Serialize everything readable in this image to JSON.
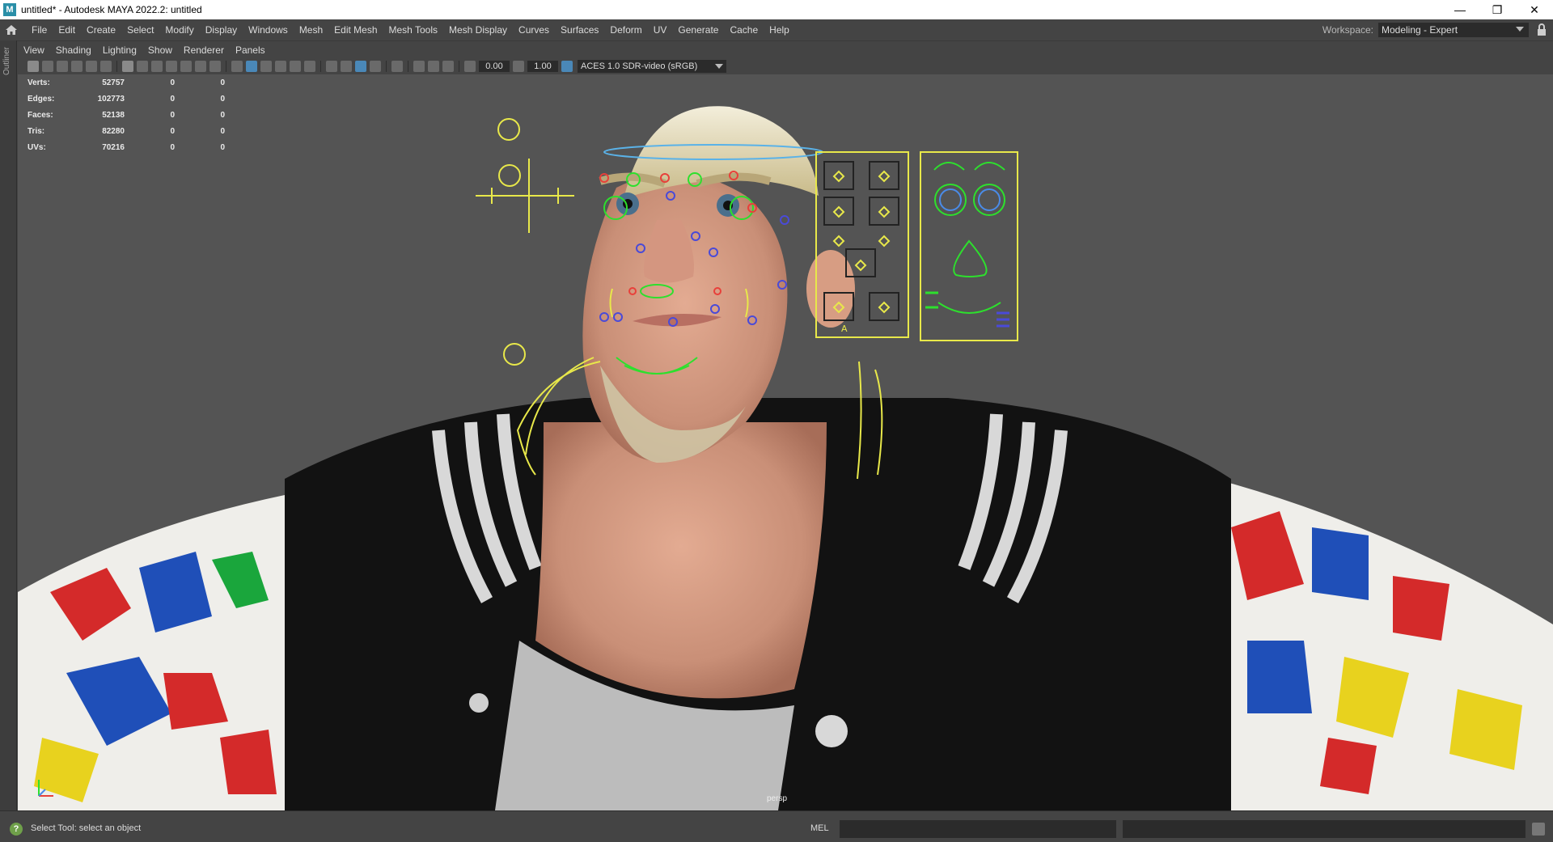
{
  "window": {
    "title": "untitled* - Autodesk MAYA 2022.2: untitled",
    "minimize": "—",
    "maximize": "❐",
    "close": "✕"
  },
  "menubar": {
    "items": [
      "File",
      "Edit",
      "Create",
      "Select",
      "Modify",
      "Display",
      "Windows",
      "Mesh",
      "Edit Mesh",
      "Mesh Tools",
      "Mesh Display",
      "Curves",
      "Surfaces",
      "Deform",
      "UV",
      "Generate",
      "Cache",
      "Help"
    ],
    "workspace_label": "Workspace:",
    "workspace_value": "Modeling - Expert"
  },
  "outliner_tab": "Outliner",
  "panel_menu": [
    "View",
    "Shading",
    "Lighting",
    "Show",
    "Renderer",
    "Panels"
  ],
  "viewport_toolbar": {
    "exposure": "0.00",
    "gamma": "1.00",
    "color_space": "ACES 1.0 SDR-video (sRGB)"
  },
  "hud": [
    {
      "label": "Verts:",
      "value": "52757",
      "sel": "0",
      "comp": "0"
    },
    {
      "label": "Edges:",
      "value": "102773",
      "sel": "0",
      "comp": "0"
    },
    {
      "label": "Faces:",
      "value": "52138",
      "sel": "0",
      "comp": "0"
    },
    {
      "label": "Tris:",
      "value": "82280",
      "sel": "0",
      "comp": "0"
    },
    {
      "label": "UVs:",
      "value": "70216",
      "sel": "0",
      "comp": "0"
    }
  ],
  "camera_label": "persp",
  "command_line": {
    "help_text": "Select Tool: select an object",
    "mel_label": "MEL"
  },
  "colors": {
    "ui_bg": "#444444",
    "viewport_bg": "#545454",
    "field_bg": "#2b2b2b",
    "rig_yellow": "#e8e84a",
    "rig_green": "#2de02d",
    "rig_red": "#e8403a",
    "rig_blue": "#4a4ad8"
  },
  "icons": [
    "home-icon",
    "lock-icon",
    "help-icon",
    "script-editor-icon"
  ]
}
